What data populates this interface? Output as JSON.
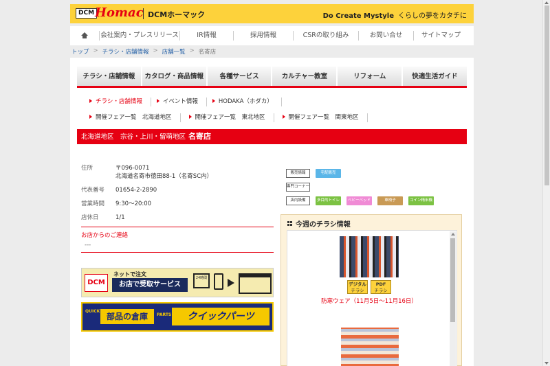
{
  "header": {
    "logo_dcm": "DCM",
    "logo_brand": "Homac",
    "logo_jp": "DCMホーマック",
    "tagline_en": "Do Create Mystyle",
    "tagline_jp": "くらしの夢をカタチに"
  },
  "global_nav": [
    "会社案内・プレスリリース",
    "IR情報",
    "採用情報",
    "CSRの取り組み",
    "お問い合せ",
    "サイトマップ"
  ],
  "breadcrumb": [
    "トップ",
    "チラシ・店舗情報",
    "店舗一覧",
    "名寄店"
  ],
  "category_tabs": [
    "チラシ・店舗情報",
    "カタログ・商品情報",
    "各種サービス",
    "カルチャー教室",
    "リフォーム",
    "快適生活ガイド"
  ],
  "sub_nav": [
    "チラシ・店舗情報",
    "イベント情報",
    "HODAKA（ホダカ）"
  ],
  "fair_nav": [
    "開催フェア一覧　北海道地区",
    "開催フェア一覧　東北地区",
    "開催フェア一覧　関東地区"
  ],
  "store": {
    "region": "北海道地区　宗谷・上川・留萌地区",
    "name": "名寄店",
    "address_label": "住所",
    "postal": "〒096-0071",
    "address": "北海道名寄市徳田88-1（名寄SC内）",
    "phone_label": "代表番号",
    "phone": "01654-2-2890",
    "hours_label": "営業時間",
    "hours": "9:30～20:00",
    "holiday_label": "店休日",
    "holiday": "1/1",
    "contact_title": "お店からのご連絡",
    "contact_value": "---"
  },
  "banners": {
    "online_dcm": "DCM",
    "online_top": "ネットで注文",
    "online_main": "お店で受取サービス",
    "online_clock": "24時間",
    "parts_quick": "QUICK",
    "parts_main": "部品の倉庫",
    "parts_en": "PARTS",
    "parts_kp": "クイックパーツ"
  },
  "services": {
    "sales_label": "販売情報",
    "sales_tag": "宅配販売",
    "corner_label": "専門コーナー",
    "facility_label": "店内設備",
    "facility_tags": [
      "多目的トイレ",
      "ベビーベッド",
      "車椅子",
      "コイン精米機"
    ]
  },
  "flyer": {
    "title": "今週のチラシ情報",
    "digital_btn": "デジタル",
    "digital_btn2": "チラシ",
    "pdf_btn": "PDF",
    "pdf_btn2": "チラシ",
    "caption": "防寒ウェア（11月5日～11月16日）"
  },
  "colors": {
    "brand_red": "#e60012",
    "brand_yellow": "#fdd23b"
  }
}
